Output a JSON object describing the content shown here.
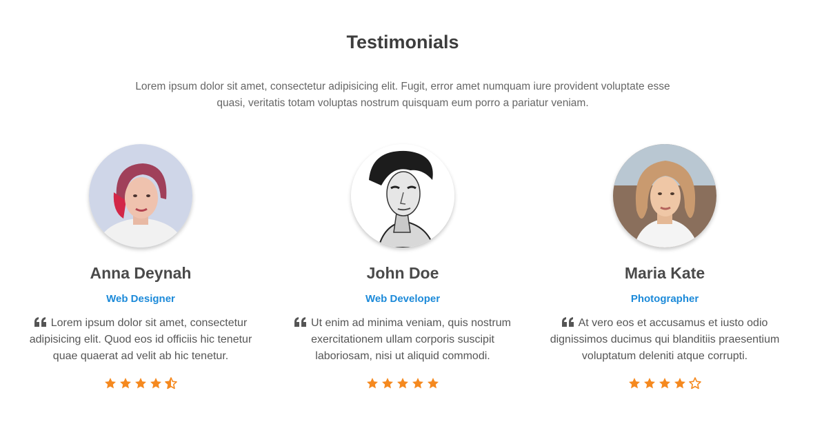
{
  "section": {
    "title": "Testimonials",
    "intro": "Lorem ipsum dolor sit amet, consectetur adipisicing elit. Fugit, error amet numquam iure provident voluptate esse quasi, veritatis totam voluptas nostrum quisquam eum porro a pariatur veniam."
  },
  "colors": {
    "accent": "#1c8ad9",
    "star": "#f5891f",
    "heading": "#3d3d3d"
  },
  "testimonials": [
    {
      "name": "Anna Deynah",
      "role": "Web Designer",
      "quote": "Lorem ipsum dolor sit amet, consectetur adipisicing elit. Quod eos id officiis hic tenetur quae quaerat ad velit ab hic tenetur.",
      "rating": 4.5,
      "avatar_icon": "woman-portrait-photo"
    },
    {
      "name": "John Doe",
      "role": "Web Developer",
      "quote": "Ut enim ad minima veniam, quis nostrum exercitationem ullam corporis suscipit laboriosam, nisi ut aliquid commodi.",
      "rating": 5,
      "avatar_icon": "man-portrait-photo"
    },
    {
      "name": "Maria Kate",
      "role": "Photographer",
      "quote": "At vero eos et accusamus et iusto odio dignissimos ducimus qui blanditiis praesentium voluptatum deleniti atque corrupti.",
      "rating": 4,
      "avatar_icon": "woman-portrait-photo"
    }
  ]
}
